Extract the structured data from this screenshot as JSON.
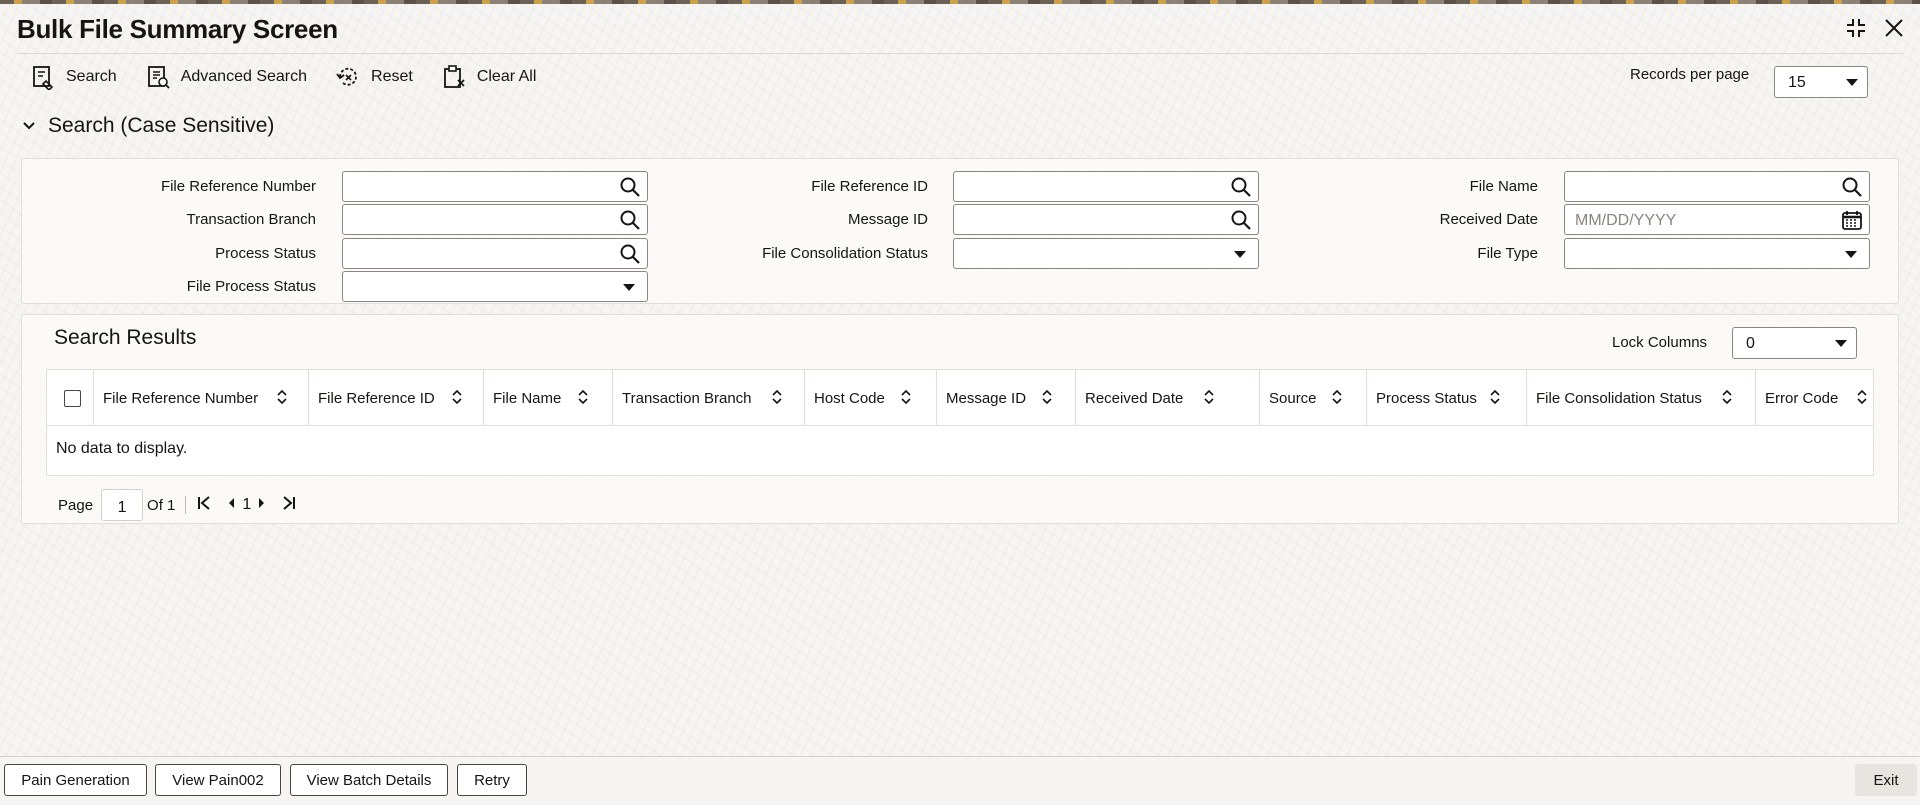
{
  "window": {
    "title": "Bulk File Summary Screen"
  },
  "toolbar": {
    "search_label": "Search",
    "advanced_search_label": "Advanced Search",
    "reset_label": "Reset",
    "clear_all_label": "Clear All",
    "records_per_page_label": "Records per page",
    "records_per_page_value": "15"
  },
  "search_section": {
    "title": "Search (Case Sensitive)",
    "fields": {
      "file_reference_number": "File Reference Number",
      "transaction_branch": "Transaction Branch",
      "process_status": "Process Status",
      "file_process_status": "File Process Status",
      "file_reference_id": "File Reference ID",
      "message_id": "Message ID",
      "file_consolidation_status": "File Consolidation Status",
      "file_name": "File Name",
      "received_date": "Received Date",
      "received_date_placeholder": "MM/DD/YYYY",
      "file_type": "File Type"
    }
  },
  "results": {
    "title": "Search Results",
    "lock_columns_label": "Lock Columns",
    "lock_columns_value": "0",
    "columns": [
      "File Reference Number",
      "File Reference ID",
      "File Name",
      "Transaction Branch",
      "Host Code",
      "Message ID",
      "Received Date",
      "Source",
      "Process Status",
      "File Consolidation Status",
      "Error Code"
    ],
    "empty_message": "No data to display.",
    "pagination": {
      "page_label": "Page",
      "page_value": "1",
      "of_label": "Of 1",
      "current_page": "1"
    }
  },
  "footer": {
    "buttons": [
      "Pain Generation",
      "View Pain002",
      "View Batch Details",
      "Retry"
    ],
    "exit_label": "Exit"
  }
}
